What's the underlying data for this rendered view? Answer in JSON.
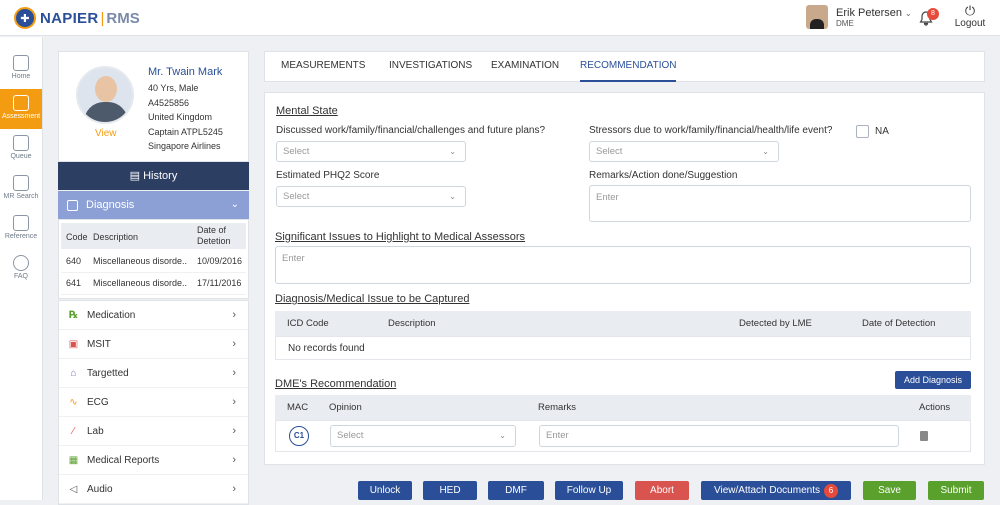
{
  "header": {
    "logo_main": "NAPIER",
    "logo_sep": "|",
    "logo_sub": "RMS",
    "user_name": "Erik Petersen",
    "user_role": "DME",
    "notifications": "8",
    "logout": "Logout"
  },
  "nav": {
    "home": "Home",
    "assessment": "Assessment",
    "queue": "Queue",
    "mr_search": "MR Search",
    "reference": "Reference",
    "faq": "FAQ"
  },
  "profile": {
    "name": "Mr. Twain Mark",
    "age_gender": "40 Yrs, Male",
    "id": "A4525856",
    "country": "United Kingdom",
    "rank": "Captain ATPL5245",
    "airline": "Singapore Airlines",
    "view": "View"
  },
  "history": "History",
  "diagnosis": {
    "title": "Diagnosis",
    "col_code": "Code",
    "col_desc": "Description",
    "col_date_1": "Date of",
    "col_date_2": "Detetion",
    "rows": [
      {
        "code": "640",
        "desc": "Miscellaneous disorde..",
        "date": "10/09/2016"
      },
      {
        "code": "641",
        "desc": "Miscellaneous disorde..",
        "date": "17/11/2016"
      }
    ]
  },
  "sidebar": {
    "items": [
      {
        "label": "Medication",
        "icon": "Rx"
      },
      {
        "label": "MSIT",
        "icon": "clipboard"
      },
      {
        "label": "Targetted",
        "icon": "building"
      },
      {
        "label": "ECG",
        "icon": "pulse"
      },
      {
        "label": "Lab",
        "icon": "pipette"
      },
      {
        "label": "Medical Reports",
        "icon": "report"
      },
      {
        "label": "Audio",
        "icon": "speaker"
      }
    ]
  },
  "tabs": [
    "MEASUREMENTS",
    "INVESTIGATIONS",
    "EXAMINATION",
    "RECOMMENDATION"
  ],
  "mental_state": {
    "title": "Mental State",
    "q1": "Discussed work/family/financial/challenges and future plans?",
    "q2": "Stressors due to work/family/financial/health/life event?",
    "na": "NA",
    "q3": "Estimated PHQ2 Score",
    "q4": "Remarks/Action done/Suggestion",
    "select_placeholder": "Select",
    "enter_placeholder": "Enter"
  },
  "significant": {
    "title": "Significant Issues to Highlight to Medical Assessors",
    "placeholder": "Enter"
  },
  "diag_capture": {
    "title": "Diagnosis/Medical Issue to be Captured",
    "col_icd": "ICD Code",
    "col_desc": "Description",
    "col_detected": "Detected by LME",
    "col_date": "Date of Detection",
    "empty": "No records found"
  },
  "dme_rec": {
    "title": "DME's Recommendation",
    "add_button": "Add Diagnosis",
    "col_mac": "MAC",
    "col_opinion": "Opinion",
    "col_remarks": "Remarks",
    "col_actions": "Actions",
    "mac_value": "C1",
    "opinion_placeholder": "Select",
    "remarks_placeholder": "Enter"
  },
  "buttons": {
    "unlock": "Unlock",
    "hed": "HED",
    "dmf": "DMF",
    "follow_up": "Follow Up",
    "abort": "Abort",
    "view_attach": "View/Attach Documents",
    "doc_count": "6",
    "save": "Save",
    "submit": "Submit"
  }
}
